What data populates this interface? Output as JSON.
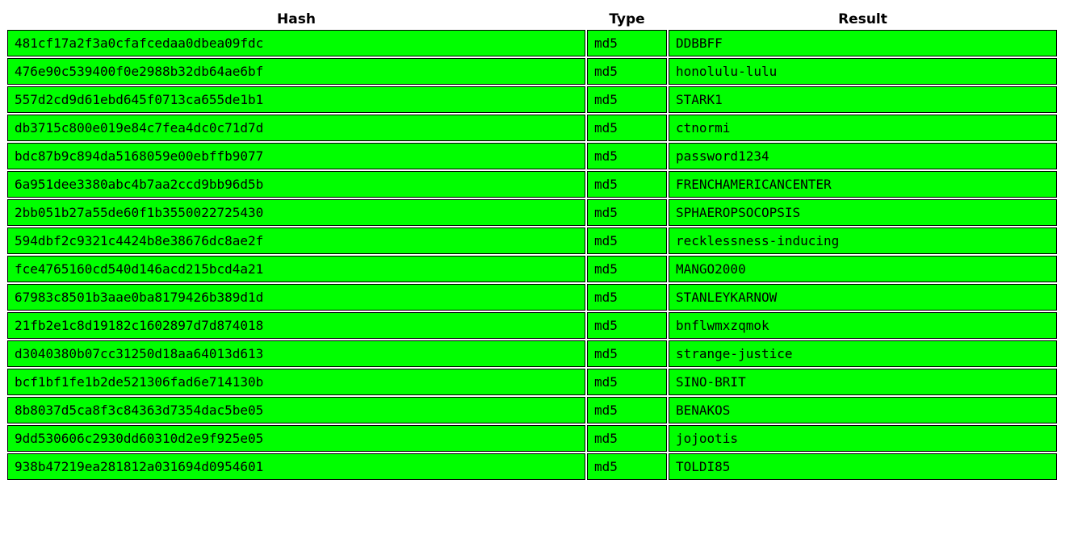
{
  "table": {
    "headers": {
      "hash": "Hash",
      "type": "Type",
      "result": "Result"
    },
    "cell_color": "#00ff00",
    "rows": [
      {
        "hash": "481cf17a2f3a0cfafcedaa0dbea09fdc",
        "type": "md5",
        "result": "DDBBFF"
      },
      {
        "hash": "476e90c539400f0e2988b32db64ae6bf",
        "type": "md5",
        "result": "honolulu-lulu"
      },
      {
        "hash": "557d2cd9d61ebd645f0713ca655de1b1",
        "type": "md5",
        "result": "STARK1"
      },
      {
        "hash": "db3715c800e019e84c7fea4dc0c71d7d",
        "type": "md5",
        "result": "ctnormi"
      },
      {
        "hash": "bdc87b9c894da5168059e00ebffb9077",
        "type": "md5",
        "result": "password1234"
      },
      {
        "hash": "6a951dee3380abc4b7aa2ccd9bb96d5b",
        "type": "md5",
        "result": "FRENCHAMERICANCENTER"
      },
      {
        "hash": "2bb051b27a55de60f1b3550022725430",
        "type": "md5",
        "result": "SPHAEROPSOCOPSIS"
      },
      {
        "hash": "594dbf2c9321c4424b8e38676dc8ae2f",
        "type": "md5",
        "result": "recklessness-inducing"
      },
      {
        "hash": "fce4765160cd540d146acd215bcd4a21",
        "type": "md5",
        "result": "MANGO2000"
      },
      {
        "hash": "67983c8501b3aae0ba8179426b389d1d",
        "type": "md5",
        "result": "STANLEYKARNOW"
      },
      {
        "hash": "21fb2e1c8d19182c1602897d7d874018",
        "type": "md5",
        "result": "bnflwmxzqmok"
      },
      {
        "hash": "d3040380b07cc31250d18aa64013d613",
        "type": "md5",
        "result": "strange-justice"
      },
      {
        "hash": "bcf1bf1fe1b2de521306fad6e714130b",
        "type": "md5",
        "result": "SINO-BRIT"
      },
      {
        "hash": "8b8037d5ca8f3c84363d7354dac5be05",
        "type": "md5",
        "result": "BENAKOS"
      },
      {
        "hash": "9dd530606c2930dd60310d2e9f925e05",
        "type": "md5",
        "result": "jojootis"
      },
      {
        "hash": "938b47219ea281812a031694d0954601",
        "type": "md5",
        "result": "TOLDI85"
      }
    ]
  }
}
